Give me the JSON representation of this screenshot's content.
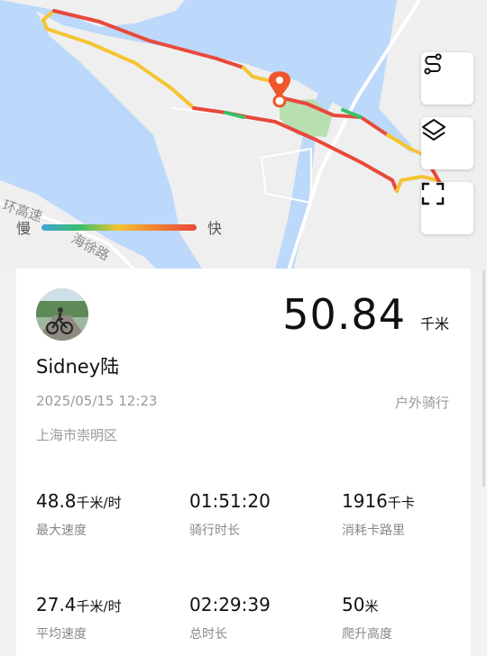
{
  "map": {
    "legend": {
      "slow_label": "慢",
      "fast_label": "快"
    },
    "place_labels": {
      "ring_expressway": "环高速",
      "road": "海徐路"
    },
    "colors": {
      "water": "#bcd8fa",
      "land": "#efefef",
      "start_pin": "#f0562c"
    },
    "buttons": {
      "route_icon": "route-icon",
      "layers_icon": "layers-icon",
      "fullscreen_icon": "fullscreen-icon"
    }
  },
  "summary": {
    "distance": "50.84",
    "distance_unit": "千米",
    "user_name": "Sidney陆",
    "datetime": "2025/05/15 12:23",
    "activity_type": "户外骑行",
    "location": "上海市崇明区"
  },
  "stats": [
    {
      "value": "48.8",
      "unit": "千米/时",
      "label": "最大速度"
    },
    {
      "value": "01:51:20",
      "unit": "",
      "label": "骑行时长"
    },
    {
      "value": "1916",
      "unit": "千卡",
      "label": "消耗卡路里"
    },
    {
      "value": "27.4",
      "unit": "千米/时",
      "label": "平均速度"
    },
    {
      "value": "02:29:39",
      "unit": "",
      "label": "总时长"
    },
    {
      "value": "50",
      "unit": "米",
      "label": "爬升高度"
    }
  ]
}
